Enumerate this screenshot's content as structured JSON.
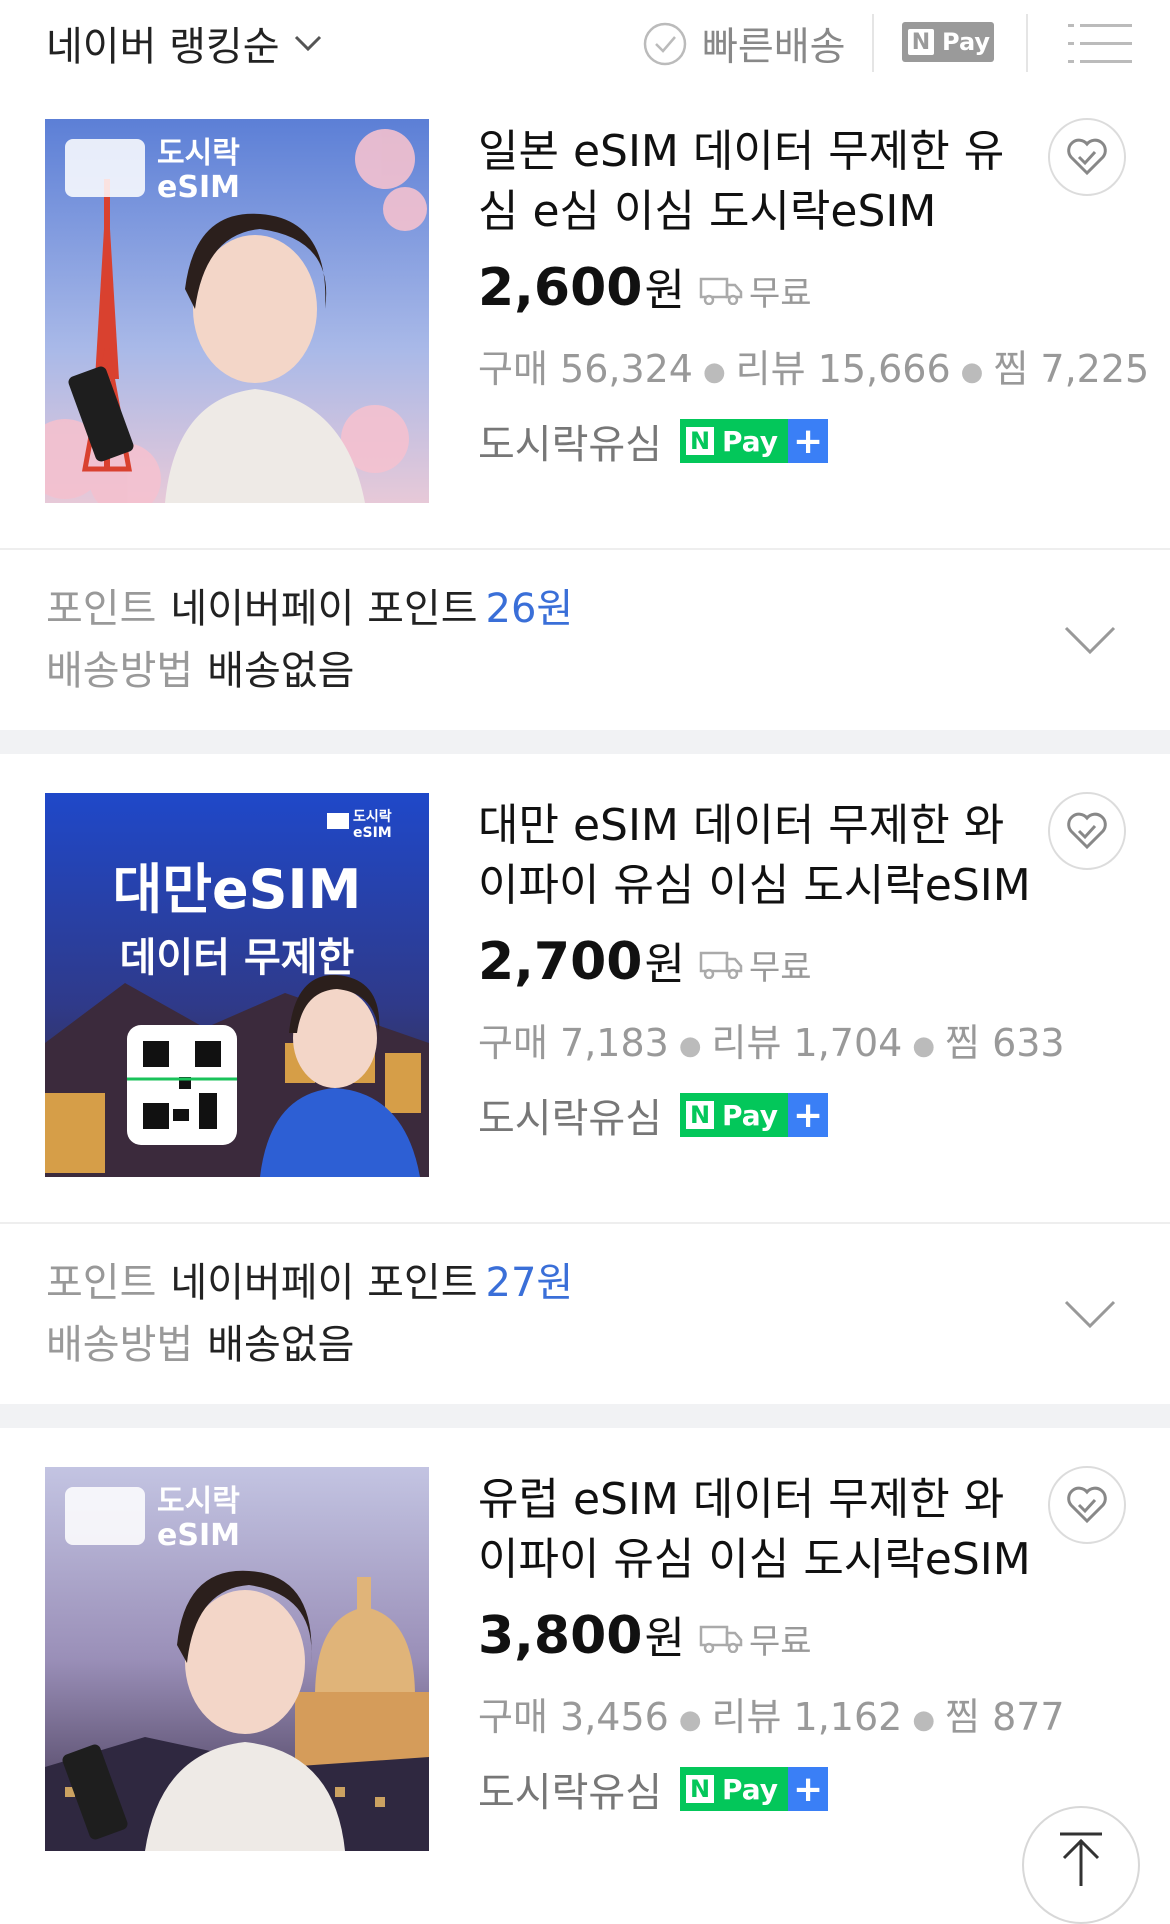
{
  "header": {
    "sort_label": "네이버 랭킹순",
    "fast_delivery_label": "빠른배송",
    "npay_filter_n": "N",
    "npay_filter_label": "Pay"
  },
  "products": [
    {
      "title": "일본 eSIM 데이터 무제한 유심 e심 이심 도시락eSIM",
      "price": "2,600",
      "currency": "원",
      "shipping": "무료",
      "purchases_label": "구매",
      "purchases": "56,324",
      "reviews_label": "리뷰",
      "reviews": "15,666",
      "wishes_label": "찜",
      "wishes": "7,225",
      "seller": "도시락유심",
      "thumb_brand": [
        "도시락",
        "eSIM"
      ],
      "points_label": "포인트",
      "points_text": "네이버페이 포인트",
      "points_value": "26원",
      "delivery_label": "배송방법",
      "delivery_value": "배송없음"
    },
    {
      "title": "대만 eSIM 데이터 무제한 와이파이 유심 이심 도시락eSIM",
      "price": "2,700",
      "currency": "원",
      "shipping": "무료",
      "purchases_label": "구매",
      "purchases": "7,183",
      "reviews_label": "리뷰",
      "reviews": "1,704",
      "wishes_label": "찜",
      "wishes": "633",
      "seller": "도시락유심",
      "thumb_headline": "대만eSIM",
      "thumb_sub": "데이터 무제한",
      "thumb_brand": [
        "도시락",
        "eSIM"
      ],
      "points_label": "포인트",
      "points_text": "네이버페이 포인트",
      "points_value": "27원",
      "delivery_label": "배송방법",
      "delivery_value": "배송없음"
    },
    {
      "title": "유럽 eSIM 데이터 무제한 와이파이 유심 이심 도시락eSIM",
      "price": "3,800",
      "currency": "원",
      "shipping": "무료",
      "purchases_label": "구매",
      "purchases": "3,456",
      "reviews_label": "리뷰",
      "reviews": "1,162",
      "wishes_label": "찜",
      "wishes": "877",
      "seller": "도시락유심",
      "thumb_brand": [
        "도시락",
        "eSIM"
      ]
    }
  ],
  "badge": {
    "n": "N",
    "pay": "Pay",
    "plus": "+"
  },
  "icons": {
    "fast_delivery": "check-circle-icon",
    "list_view": "list-view-icon",
    "wish": "heart-icon",
    "shipping": "truck-icon",
    "expand": "chevron-down-icon",
    "scroll_top": "arrow-up-icon"
  },
  "colors": {
    "npay_green": "#03c75a",
    "plus_blue": "#3a7ff6",
    "point_blue": "#3a6fd8"
  }
}
